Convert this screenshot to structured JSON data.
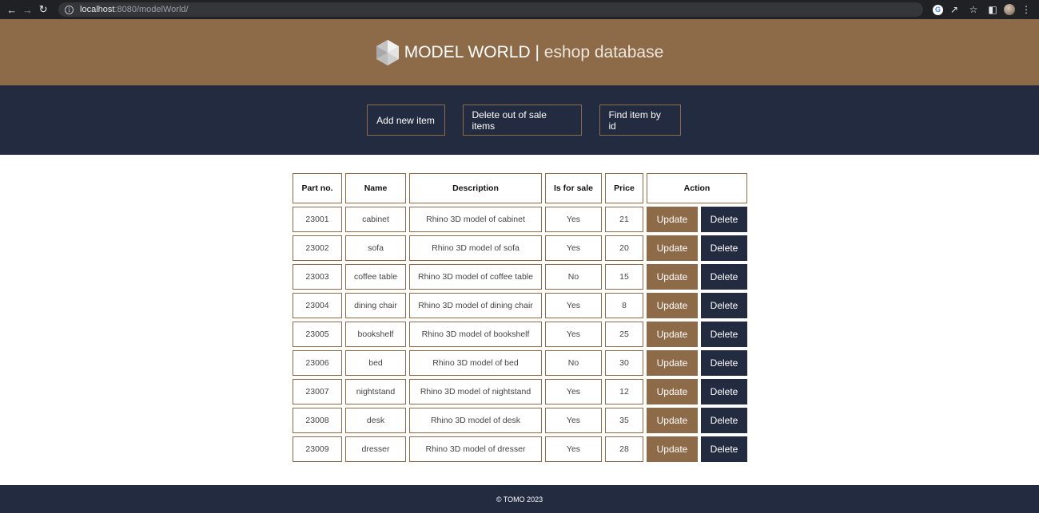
{
  "browser": {
    "url_host": "localhost",
    "url_rest": ":8080/modelWorld/"
  },
  "header": {
    "brand_main": "MODEL WORLD",
    "separator": "|",
    "brand_sub": "eshop database"
  },
  "navbar": {
    "add_label": "Add new item",
    "delete_out_label": "Delete out of sale items",
    "find_label": "Find item by id"
  },
  "table": {
    "columns": [
      "Part no.",
      "Name",
      "Description",
      "Is for sale",
      "Price",
      "Action"
    ],
    "update_label": "Update",
    "delete_label": "Delete",
    "rows": [
      {
        "part": "23001",
        "name": "cabinet",
        "description": "Rhino 3D model of cabinet",
        "for_sale": "Yes",
        "price": "21"
      },
      {
        "part": "23002",
        "name": "sofa",
        "description": "Rhino 3D model of sofa",
        "for_sale": "Yes",
        "price": "20"
      },
      {
        "part": "23003",
        "name": "coffee table",
        "description": "Rhino 3D model of coffee table",
        "for_sale": "No",
        "price": "15"
      },
      {
        "part": "23004",
        "name": "dining chair",
        "description": "Rhino 3D model of dining chair",
        "for_sale": "Yes",
        "price": "8"
      },
      {
        "part": "23005",
        "name": "bookshelf",
        "description": "Rhino 3D model of bookshelf",
        "for_sale": "Yes",
        "price": "25"
      },
      {
        "part": "23006",
        "name": "bed",
        "description": "Rhino 3D model of bed",
        "for_sale": "No",
        "price": "30"
      },
      {
        "part": "23007",
        "name": "nightstand",
        "description": "Rhino 3D model of nightstand",
        "for_sale": "Yes",
        "price": "12"
      },
      {
        "part": "23008",
        "name": "desk",
        "description": "Rhino 3D model of desk",
        "for_sale": "Yes",
        "price": "35"
      },
      {
        "part": "23009",
        "name": "dresser",
        "description": "Rhino 3D model of dresser",
        "for_sale": "Yes",
        "price": "28"
      }
    ]
  },
  "footer": {
    "text": "© TOMO 2023"
  },
  "colors": {
    "brown": "#8d6a48",
    "navy": "#232b40"
  }
}
